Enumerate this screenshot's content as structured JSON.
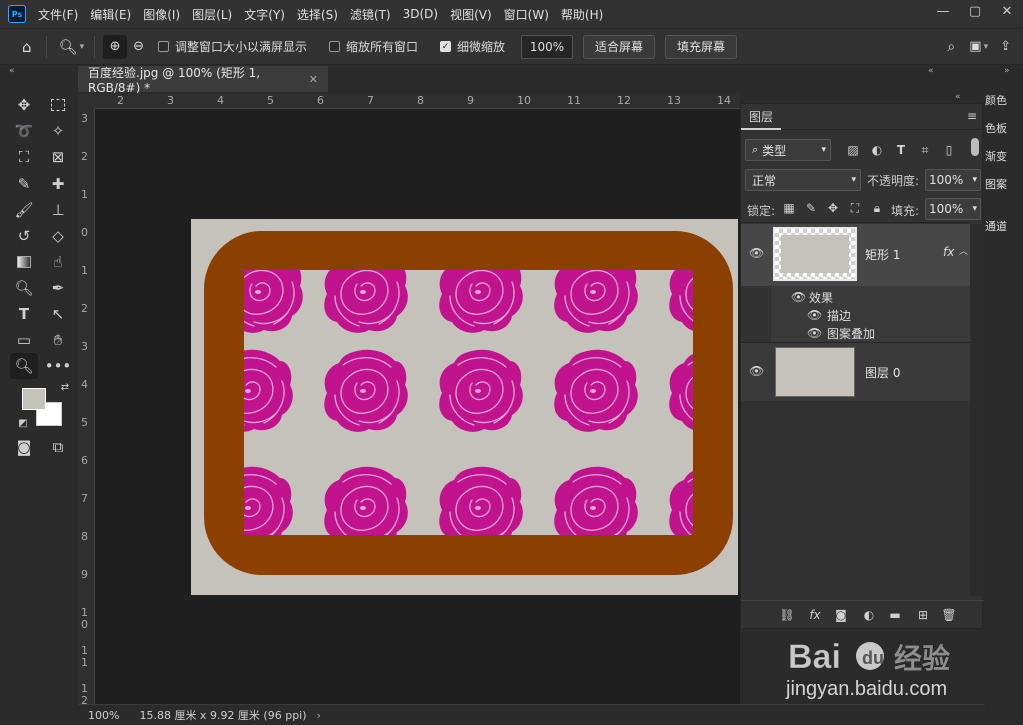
{
  "menu": {
    "logo": "Ps",
    "items": [
      "文件(F)",
      "编辑(E)",
      "图像(I)",
      "图层(L)",
      "文字(Y)",
      "选择(S)",
      "滤镜(T)",
      "3D(D)",
      "视图(V)",
      "窗口(W)",
      "帮助(H)"
    ]
  },
  "options": {
    "resize_windows_label": "调整窗口大小以满屏显示",
    "resize_windows_checked": false,
    "zoom_all_label": "缩放所有窗口",
    "zoom_all_checked": false,
    "scrubby_zoom_label": "细微缩放",
    "scrubby_zoom_checked": true,
    "zoom_value": "100%",
    "fit_screen_label": "适合屏幕",
    "fill_screen_label": "填充屏幕"
  },
  "document": {
    "tab_title": "百度经验.jpg @ 100% (矩形 1, RGB/8#) *",
    "zoom_status": "100%",
    "size_status": "15.88 厘米 x 9.92 厘米 (96 ppi)",
    "ruler_top_labels": [
      "2",
      "3",
      "4",
      "5",
      "6",
      "7",
      "8",
      "9",
      "10",
      "11",
      "12",
      "13",
      "14"
    ],
    "ruler_left_labels": [
      "3",
      "2",
      "1",
      "0",
      "1",
      "2",
      "3",
      "4",
      "5",
      "6",
      "7",
      "8",
      "9",
      "1\n0",
      "1\n1",
      "1\n2"
    ]
  },
  "colors": {
    "foreground": "#c4c2bb",
    "background": "#ffffff",
    "frame": "#8b3f00",
    "rose": "#c0138d",
    "paper": "#c4c2bb"
  },
  "layers_panel": {
    "tab": "图层",
    "filter_kind": "类型",
    "blend_mode": "正常",
    "opacity_label": "不透明度:",
    "opacity_value": "100%",
    "lock_label": "锁定:",
    "fill_label": "填充:",
    "fill_value": "100%",
    "layers": [
      {
        "name": "矩形 1",
        "fx": "fx",
        "selected": true
      },
      {
        "name": "图层 0",
        "selected": false
      }
    ],
    "effects_label": "效果",
    "effects": [
      "描边",
      "图案叠加"
    ]
  },
  "right_dock": {
    "items": [
      "颜色",
      "色板",
      "渐变",
      "图案",
      "通道"
    ]
  },
  "tools": [
    "move-tool",
    "marquee-tool",
    "lasso-tool",
    "magic-wand-tool",
    "crop-tool",
    "frame-tool",
    "eyedropper-tool",
    "healing-brush-tool",
    "brush-tool",
    "stamp-tool",
    "history-brush-tool",
    "eraser-tool",
    "gradient-tool",
    "smudge-tool",
    "dodge-tool",
    "pen-tool",
    "type-tool",
    "path-select-tool",
    "shape-tool",
    "hand-tool",
    "zoom-tool",
    "more-tools"
  ],
  "watermark": {
    "brand": "Bai 经验",
    "url": "jingyan.baidu.com"
  }
}
